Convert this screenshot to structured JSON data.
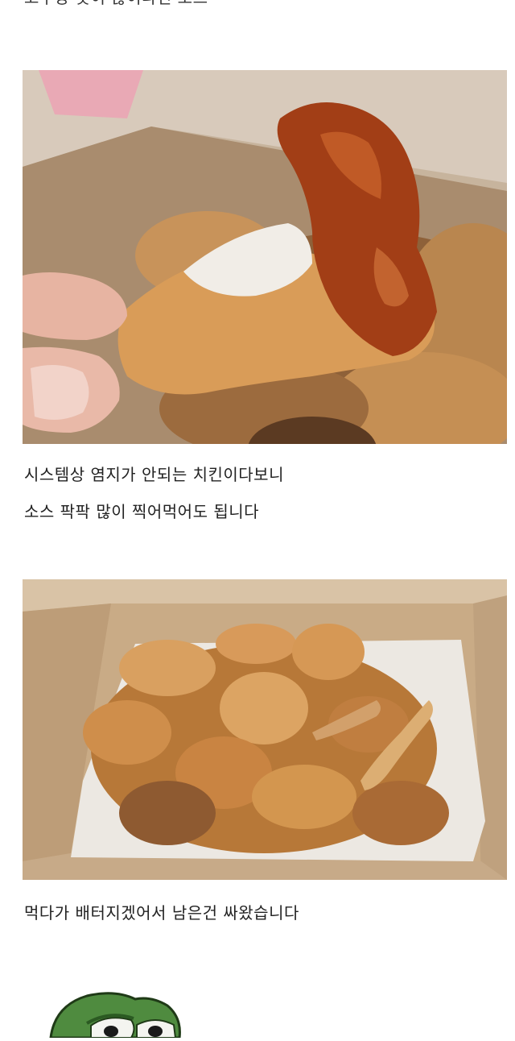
{
  "post": {
    "top_caption_cut": "고추장 맛이 많이나던 소스",
    "photo1": {
      "alt": "Fried chicken piece with sauce held over box"
    },
    "caption2": {
      "line1": "시스템상 염지가 안되는 치킨이다보니",
      "line2": "소스 팍팍 많이 찍어먹어도 됩니다"
    },
    "photo2": {
      "alt": "Box of leftover fried chicken pieces"
    },
    "caption3": "먹다가 배터지겠어서 남은건 싸왔습니다",
    "sticker": "pepe-frog"
  },
  "colors": {
    "text": "#222222",
    "background": "#ffffff",
    "box_cardboard": "#c9ab86",
    "fried_chicken": "#c98a45",
    "sauce": "#a13f18",
    "pepe_green": "#4f8b3f"
  }
}
